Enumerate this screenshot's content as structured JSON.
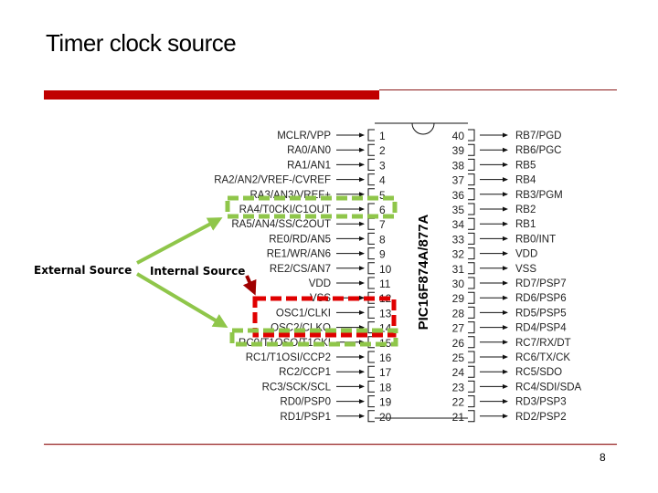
{
  "slide": {
    "title": "Timer clock source",
    "page_number": "8"
  },
  "colors": {
    "accent_red": "#c00000",
    "external_highlight": "#8fc64a",
    "internal_highlight": "#e00000",
    "internal_arrow": "#a00000"
  },
  "annotations": {
    "external_source": "External Source",
    "internal_source": "Internal Source"
  },
  "chip": {
    "name": "PIC16F874A/877A",
    "left_pins": [
      {
        "num": "1",
        "label": "MCLR/VPP"
      },
      {
        "num": "2",
        "label": "RA0/AN0"
      },
      {
        "num": "3",
        "label": "RA1/AN1"
      },
      {
        "num": "4",
        "label": "RA2/AN2/VREF-/CVREF"
      },
      {
        "num": "5",
        "label": "RA3/AN3/VREF+"
      },
      {
        "num": "6",
        "label": "RA4/T0CKI/C1OUT"
      },
      {
        "num": "7",
        "label": "RA5/AN4/SS/C2OUT"
      },
      {
        "num": "8",
        "label": "RE0/RD/AN5"
      },
      {
        "num": "9",
        "label": "RE1/WR/AN6"
      },
      {
        "num": "10",
        "label": "RE2/CS/AN7"
      },
      {
        "num": "11",
        "label": "VDD"
      },
      {
        "num": "12",
        "label": "VSS"
      },
      {
        "num": "13",
        "label": "OSC1/CLKI"
      },
      {
        "num": "14",
        "label": "OSC2/CLKO"
      },
      {
        "num": "15",
        "label": "RC0/T1OSO/T1CKI"
      },
      {
        "num": "16",
        "label": "RC1/T1OSI/CCP2"
      },
      {
        "num": "17",
        "label": "RC2/CCP1"
      },
      {
        "num": "18",
        "label": "RC3/SCK/SCL"
      },
      {
        "num": "19",
        "label": "RD0/PSP0"
      },
      {
        "num": "20",
        "label": "RD1/PSP1"
      }
    ],
    "right_pins": [
      {
        "num": "40",
        "label": "RB7/PGD"
      },
      {
        "num": "39",
        "label": "RB6/PGC"
      },
      {
        "num": "38",
        "label": "RB5"
      },
      {
        "num": "37",
        "label": "RB4"
      },
      {
        "num": "36",
        "label": "RB3/PGM"
      },
      {
        "num": "35",
        "label": "RB2"
      },
      {
        "num": "34",
        "label": "RB1"
      },
      {
        "num": "33",
        "label": "RB0/INT"
      },
      {
        "num": "32",
        "label": "VDD"
      },
      {
        "num": "31",
        "label": "VSS"
      },
      {
        "num": "30",
        "label": "RD7/PSP7"
      },
      {
        "num": "29",
        "label": "RD6/PSP6"
      },
      {
        "num": "28",
        "label": "RD5/PSP5"
      },
      {
        "num": "27",
        "label": "RD4/PSP4"
      },
      {
        "num": "26",
        "label": "RC7/RX/DT"
      },
      {
        "num": "25",
        "label": "RC6/TX/CK"
      },
      {
        "num": "24",
        "label": "RC5/SDO"
      },
      {
        "num": "23",
        "label": "RC4/SDI/SDA"
      },
      {
        "num": "22",
        "label": "RD3/PSP3"
      },
      {
        "num": "21",
        "label": "RD2/PSP2"
      }
    ]
  }
}
